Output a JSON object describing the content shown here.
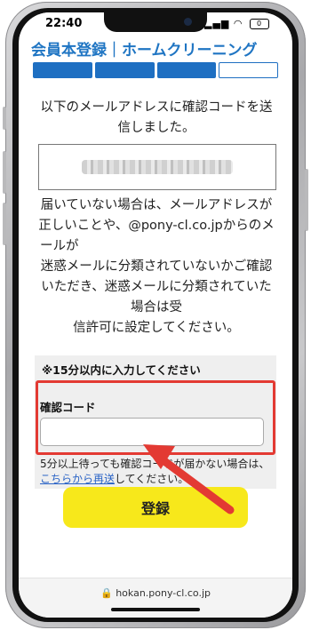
{
  "status": {
    "time": "22:40",
    "battery": "0",
    "signal": "signal-bars-icon",
    "wifi": "wifi-icon"
  },
  "header": {
    "site_title": "会員本登録｜ホームクリーニング"
  },
  "progress": {
    "steps_total": 4,
    "steps_done": 3
  },
  "message": {
    "line1": "以下のメールアドレスに確認コードを送",
    "line2": "信しました。"
  },
  "email_display": {
    "masked": true
  },
  "notice": {
    "l1": "届いていない場合は、メールアドレスが",
    "l2": "正しいことや、@pony-cl.co.jpからのメ",
    "l3": "ールが",
    "l4": "迷惑メールに分類されていないかご確認",
    "l5": "いただき、迷惑メールに分類されていた",
    "l6": "場合は受",
    "l7": "信許可に設定してください。"
  },
  "code_form": {
    "time_note": "※15分以内に入力してください",
    "label": "確認コード",
    "value": "",
    "resend_text1": "5分以上待っても確認コードが届かない場合は、",
    "resend_link": "こちらから再送",
    "resend_text2": "してください。"
  },
  "submit_label": "登録",
  "url": "hokan.pony-cl.co.jp",
  "colors": {
    "accent": "#1e6fc2",
    "highlight": "#e33a33",
    "button": "#f7e81b",
    "link": "#2a63c6"
  }
}
